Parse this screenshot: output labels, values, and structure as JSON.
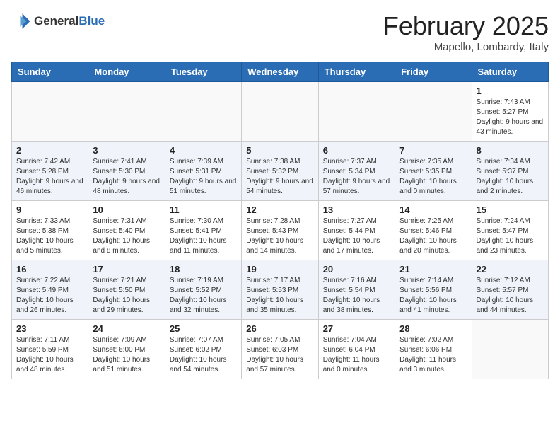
{
  "header": {
    "logo_general": "General",
    "logo_blue": "Blue",
    "title": "February 2025",
    "subtitle": "Mapello, Lombardy, Italy"
  },
  "days_of_week": [
    "Sunday",
    "Monday",
    "Tuesday",
    "Wednesday",
    "Thursday",
    "Friday",
    "Saturday"
  ],
  "weeks": [
    [
      {
        "day": "",
        "info": ""
      },
      {
        "day": "",
        "info": ""
      },
      {
        "day": "",
        "info": ""
      },
      {
        "day": "",
        "info": ""
      },
      {
        "day": "",
        "info": ""
      },
      {
        "day": "",
        "info": ""
      },
      {
        "day": "1",
        "info": "Sunrise: 7:43 AM\nSunset: 5:27 PM\nDaylight: 9 hours and 43 minutes."
      }
    ],
    [
      {
        "day": "2",
        "info": "Sunrise: 7:42 AM\nSunset: 5:28 PM\nDaylight: 9 hours and 46 minutes."
      },
      {
        "day": "3",
        "info": "Sunrise: 7:41 AM\nSunset: 5:30 PM\nDaylight: 9 hours and 48 minutes."
      },
      {
        "day": "4",
        "info": "Sunrise: 7:39 AM\nSunset: 5:31 PM\nDaylight: 9 hours and 51 minutes."
      },
      {
        "day": "5",
        "info": "Sunrise: 7:38 AM\nSunset: 5:32 PM\nDaylight: 9 hours and 54 minutes."
      },
      {
        "day": "6",
        "info": "Sunrise: 7:37 AM\nSunset: 5:34 PM\nDaylight: 9 hours and 57 minutes."
      },
      {
        "day": "7",
        "info": "Sunrise: 7:35 AM\nSunset: 5:35 PM\nDaylight: 10 hours and 0 minutes."
      },
      {
        "day": "8",
        "info": "Sunrise: 7:34 AM\nSunset: 5:37 PM\nDaylight: 10 hours and 2 minutes."
      }
    ],
    [
      {
        "day": "9",
        "info": "Sunrise: 7:33 AM\nSunset: 5:38 PM\nDaylight: 10 hours and 5 minutes."
      },
      {
        "day": "10",
        "info": "Sunrise: 7:31 AM\nSunset: 5:40 PM\nDaylight: 10 hours and 8 minutes."
      },
      {
        "day": "11",
        "info": "Sunrise: 7:30 AM\nSunset: 5:41 PM\nDaylight: 10 hours and 11 minutes."
      },
      {
        "day": "12",
        "info": "Sunrise: 7:28 AM\nSunset: 5:43 PM\nDaylight: 10 hours and 14 minutes."
      },
      {
        "day": "13",
        "info": "Sunrise: 7:27 AM\nSunset: 5:44 PM\nDaylight: 10 hours and 17 minutes."
      },
      {
        "day": "14",
        "info": "Sunrise: 7:25 AM\nSunset: 5:46 PM\nDaylight: 10 hours and 20 minutes."
      },
      {
        "day": "15",
        "info": "Sunrise: 7:24 AM\nSunset: 5:47 PM\nDaylight: 10 hours and 23 minutes."
      }
    ],
    [
      {
        "day": "16",
        "info": "Sunrise: 7:22 AM\nSunset: 5:49 PM\nDaylight: 10 hours and 26 minutes."
      },
      {
        "day": "17",
        "info": "Sunrise: 7:21 AM\nSunset: 5:50 PM\nDaylight: 10 hours and 29 minutes."
      },
      {
        "day": "18",
        "info": "Sunrise: 7:19 AM\nSunset: 5:52 PM\nDaylight: 10 hours and 32 minutes."
      },
      {
        "day": "19",
        "info": "Sunrise: 7:17 AM\nSunset: 5:53 PM\nDaylight: 10 hours and 35 minutes."
      },
      {
        "day": "20",
        "info": "Sunrise: 7:16 AM\nSunset: 5:54 PM\nDaylight: 10 hours and 38 minutes."
      },
      {
        "day": "21",
        "info": "Sunrise: 7:14 AM\nSunset: 5:56 PM\nDaylight: 10 hours and 41 minutes."
      },
      {
        "day": "22",
        "info": "Sunrise: 7:12 AM\nSunset: 5:57 PM\nDaylight: 10 hours and 44 minutes."
      }
    ],
    [
      {
        "day": "23",
        "info": "Sunrise: 7:11 AM\nSunset: 5:59 PM\nDaylight: 10 hours and 48 minutes."
      },
      {
        "day": "24",
        "info": "Sunrise: 7:09 AM\nSunset: 6:00 PM\nDaylight: 10 hours and 51 minutes."
      },
      {
        "day": "25",
        "info": "Sunrise: 7:07 AM\nSunset: 6:02 PM\nDaylight: 10 hours and 54 minutes."
      },
      {
        "day": "26",
        "info": "Sunrise: 7:05 AM\nSunset: 6:03 PM\nDaylight: 10 hours and 57 minutes."
      },
      {
        "day": "27",
        "info": "Sunrise: 7:04 AM\nSunset: 6:04 PM\nDaylight: 11 hours and 0 minutes."
      },
      {
        "day": "28",
        "info": "Sunrise: 7:02 AM\nSunset: 6:06 PM\nDaylight: 11 hours and 3 minutes."
      },
      {
        "day": "",
        "info": ""
      }
    ]
  ]
}
